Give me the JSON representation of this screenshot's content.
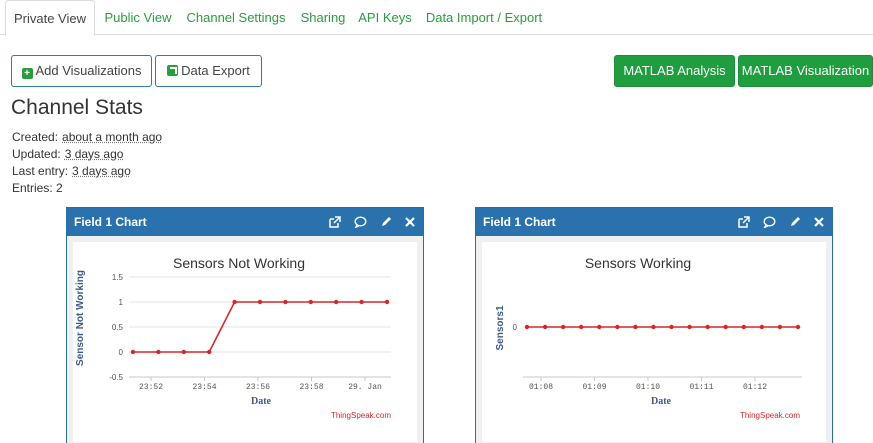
{
  "tabs": [
    {
      "label": "Private View",
      "active": true
    },
    {
      "label": "Public View"
    },
    {
      "label": "Channel Settings"
    },
    {
      "label": "Sharing"
    },
    {
      "label": "API Keys"
    },
    {
      "label": "Data Import / Export"
    }
  ],
  "buttons": {
    "add_visualizations": "Add Visualizations",
    "data_export": "Data Export",
    "matlab_analysis": "MATLAB Analysis",
    "matlab_visualization": "MATLAB Visualization"
  },
  "stats": {
    "title": "Channel Stats",
    "created_label": "Created:",
    "created_value": "about a month ago",
    "updated_label": "Updated:",
    "updated_value": "3 days ago",
    "last_entry_label": "Last entry:",
    "last_entry_value": "3 days ago",
    "entries": "Entries: 2"
  },
  "colors": {
    "accent_green": "#1e9e3e",
    "panel_blue": "#2a72ad",
    "series_red": "#d62728",
    "axis_label_blue": "#3b5a8c"
  },
  "panels": [
    {
      "header": "Field 1 Chart",
      "credit": "ThingSpeak.com"
    },
    {
      "header": "Field 1 Chart",
      "credit": "ThingSpeak.com"
    }
  ],
  "chart_data": [
    {
      "type": "line",
      "title": "Sensors Not Working",
      "xlabel": "Date",
      "ylabel": "Sensor Not Working",
      "ylim": [
        -0.5,
        1.5
      ],
      "yticks": [
        -0.5,
        0,
        0.5,
        1,
        1.5
      ],
      "xticks": [
        "23:52",
        "23:54",
        "23:56",
        "23:58",
        "29. Jan"
      ],
      "grid": true,
      "series": [
        {
          "values": [
            0,
            0,
            0,
            0,
            1,
            1,
            1,
            1,
            1,
            1,
            1
          ]
        }
      ]
    },
    {
      "type": "line",
      "title": "Sensors Working",
      "xlabel": "Date",
      "ylabel": "Sensors1",
      "yticks": [
        0
      ],
      "xticks": [
        "01:08",
        "01:09",
        "01:10",
        "01:11",
        "01:12"
      ],
      "grid": true,
      "series": [
        {
          "values": [
            0,
            0,
            0,
            0,
            0,
            0,
            0,
            0,
            0,
            0,
            0,
            0,
            0,
            0,
            0,
            0
          ]
        }
      ]
    }
  ]
}
